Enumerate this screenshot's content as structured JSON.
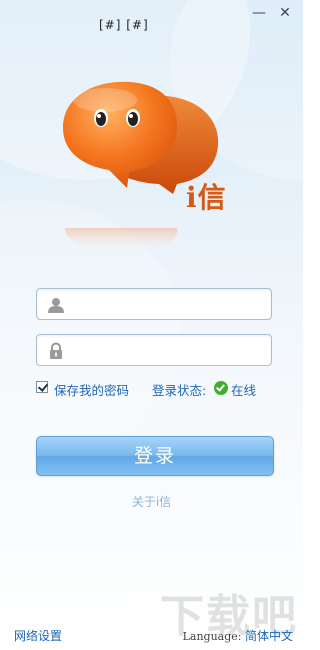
{
  "titlebar": {
    "brackets_text": "[#] [#]",
    "minimize_symbol": "—",
    "close_symbol": "✕"
  },
  "logo": {
    "icon": "chat-bubble-icon",
    "brand_text": "i信",
    "colors": {
      "bubble": "#f4751e",
      "bubble_back": "#e0560f",
      "brand": "#d45a16"
    }
  },
  "login_form": {
    "username": {
      "icon": "user-icon",
      "value": "",
      "placeholder": ""
    },
    "password": {
      "icon": "lock-icon",
      "value": "",
      "placeholder": ""
    },
    "remember_password": {
      "label": "保存我的密码",
      "checked": true
    },
    "status": {
      "label": "登录状态:",
      "value": "在线",
      "icon": "online-check-icon"
    },
    "login_button": "登录",
    "about_link": "关于i信"
  },
  "footer": {
    "network_settings": "网络设置",
    "language_label": "Language:",
    "language_value": "简体中文"
  },
  "watermark": {
    "text": "下载吧"
  },
  "colors": {
    "accent": "#1e66b5",
    "button": "#79b8ee",
    "online": "#3fae2a"
  }
}
